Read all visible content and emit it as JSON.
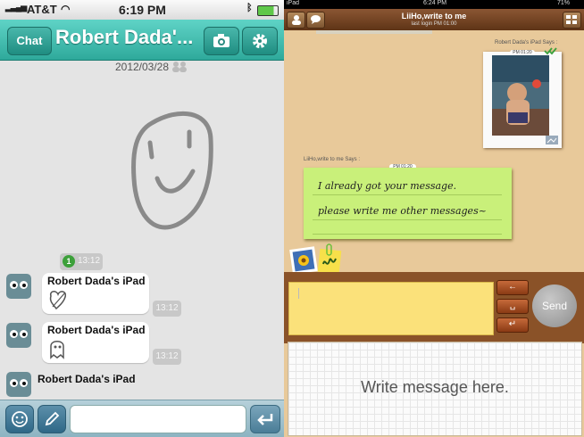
{
  "phone": {
    "status": {
      "carrier": "AT&T",
      "time": "6:19 PM"
    },
    "nav": {
      "back_label": "Chat",
      "title": "Robert Dada'..."
    },
    "chat": {
      "date": "2012/03/28",
      "unread_count": "1",
      "sent_time": "13:12",
      "messages": [
        {
          "sender": "Robert Dada's iPad",
          "time": "13:12"
        },
        {
          "sender": "Robert Dada's iPad",
          "time": "13:12"
        },
        {
          "sender": "Robert Dada's iPad"
        }
      ]
    },
    "input": {
      "placeholder": ""
    },
    "icons": {
      "camera": "camera-icon",
      "settings": "gear-icon",
      "emoji": "smiley-icon",
      "draw": "pencil-icon",
      "send": "return-arrow-icon"
    }
  },
  "ipad": {
    "status": {
      "device": "iPad",
      "time": "6:24 PM",
      "battery": "71%"
    },
    "header": {
      "title": "LiiHo,write to me",
      "subtitle": "last login PM 01:00"
    },
    "photo_message": {
      "says": "Robert Dada's iPad Says :",
      "time": "PM 01:20"
    },
    "note_message": {
      "says": "LiiHo,write to me Says :",
      "time": "PM 01:20",
      "line1": "I already got your message.",
      "line2": "please write  me  other messages~"
    },
    "compose": {
      "send_label": "Send",
      "backspace": "←",
      "space": "␣",
      "enter": "↵",
      "hint": "Write message here."
    },
    "colors": {
      "note": "#c9f07a",
      "pad": "#fbe17a",
      "wood": "#e7c896"
    }
  }
}
